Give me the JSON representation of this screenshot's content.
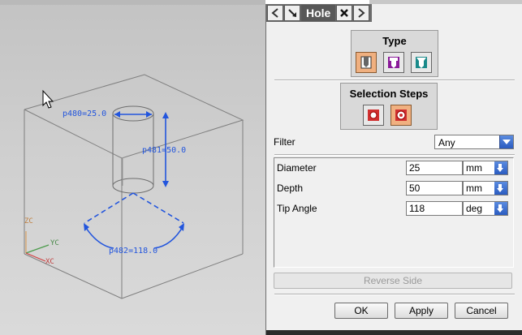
{
  "viewport": {
    "annotations": {
      "p480": "p480=25.0",
      "p481": "p481=50.0",
      "p482": "p482=118.0"
    },
    "axes": {
      "zc": "ZC",
      "yc": "YC",
      "xc": "XC"
    }
  },
  "dialog": {
    "title": "Hole",
    "type_group": {
      "title": "Type"
    },
    "selection_group": {
      "title": "Selection Steps"
    },
    "filter": {
      "label": "Filter",
      "value": "Any"
    },
    "params": [
      {
        "name": "Diameter",
        "value": "25",
        "unit": "mm"
      },
      {
        "name": "Depth",
        "value": "50",
        "unit": "mm"
      },
      {
        "name": "Tip Angle",
        "value": "118",
        "unit": "deg"
      }
    ],
    "reverse_side_label": "Reverse Side",
    "ok_label": "OK",
    "apply_label": "Apply",
    "cancel_label": "Cancel"
  },
  "colors": {
    "dimension_blue": "#2255dd",
    "edge_gray": "#7a7a7a",
    "active_button": "#f0b080"
  }
}
